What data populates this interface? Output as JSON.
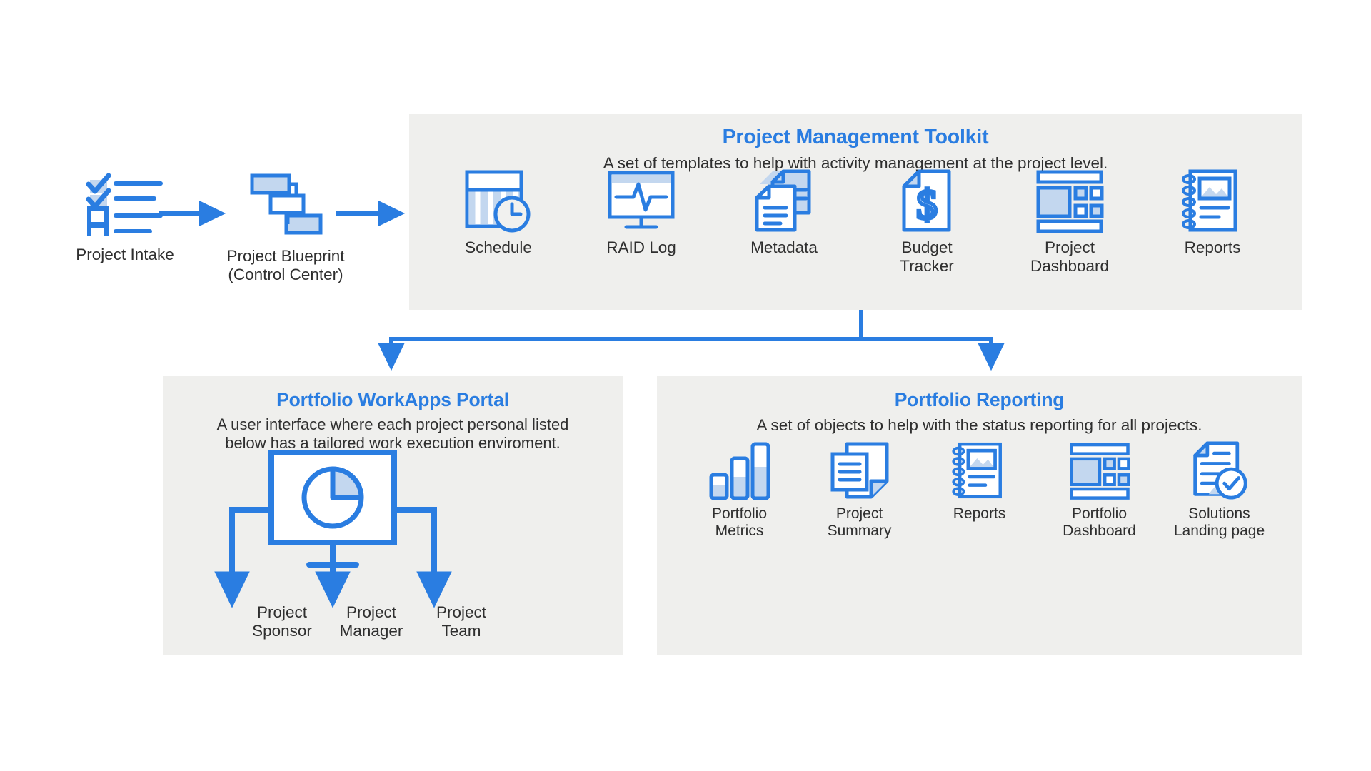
{
  "flow": {
    "nodes": [
      {
        "label": "Project Intake",
        "icon": "checklist-icon"
      },
      {
        "label": "Project Blueprint\n(Control Center)",
        "icon": "gantt-icon"
      }
    ],
    "arrows": [
      {
        "name": "arrow-intake-to-blueprint"
      },
      {
        "name": "arrow-blueprint-to-toolkit"
      }
    ]
  },
  "toolkit": {
    "title": "Project Management Toolkit",
    "subtitle": "A set of templates to help with activity management at the project level.",
    "items": [
      {
        "label": "Schedule",
        "icon": "schedule-calendar-clock-icon"
      },
      {
        "label": "RAID Log",
        "icon": "monitor-pulse-icon"
      },
      {
        "label": "Metadata",
        "icon": "stacked-documents-icon"
      },
      {
        "label": "Budget\nTracker",
        "icon": "dollar-document-icon"
      },
      {
        "label": "Project\nDashboard",
        "icon": "dashboard-layout-icon"
      },
      {
        "label": "Reports",
        "icon": "spiral-notebook-icon"
      }
    ]
  },
  "workapps": {
    "title": "Portfolio WorkApps Portal",
    "subtitle": "A user interface where each project personal listed\nbelow has a tailored work execution enviroment.",
    "center_icon": "pie-chart-screen-icon",
    "roles": [
      {
        "label": "Project\nSponsor"
      },
      {
        "label": "Project\nManager"
      },
      {
        "label": "Project\nTeam"
      }
    ]
  },
  "reporting": {
    "title": "Portfolio Reporting",
    "subtitle": "A set of objects to help with the status reporting for all projects.",
    "items": [
      {
        "label": "Portfolio\nMetrics",
        "icon": "bar-chart-icon"
      },
      {
        "label": "Project\nSummary",
        "icon": "document-pages-icon"
      },
      {
        "label": "Reports",
        "icon": "spiral-notebook-icon"
      },
      {
        "label": "Portfolio\nDashboard",
        "icon": "dashboard-layout-icon"
      },
      {
        "label": "Solutions\nLanding page",
        "icon": "document-check-icon"
      }
    ]
  },
  "colors": {
    "accent_blue": "#2a7de1",
    "icon_stroke": "#2a7de1",
    "icon_fill_light": "#c3d7ef",
    "panel_background": "#efefed",
    "text": "#2f2f2f",
    "page_background": "#ffffff"
  }
}
